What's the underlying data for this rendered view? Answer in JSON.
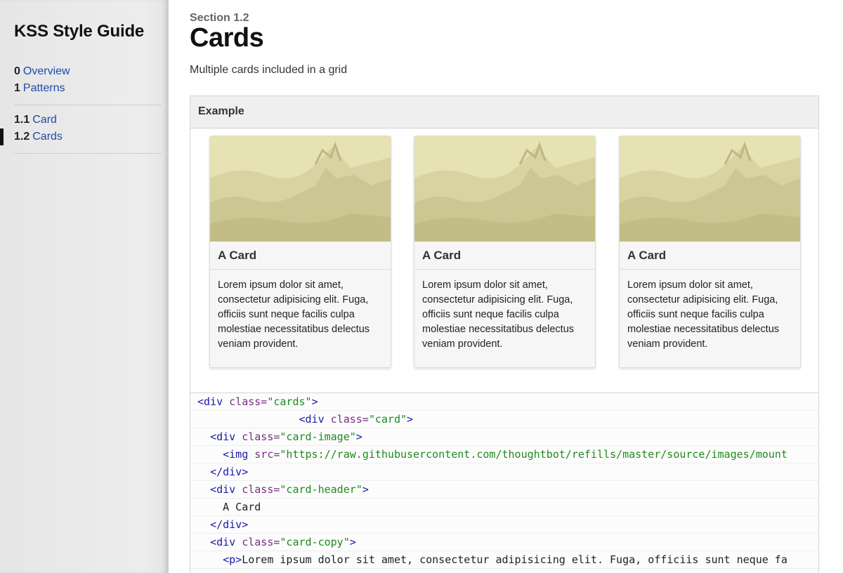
{
  "sidebar": {
    "brand": "KSS Style Guide",
    "top_items": [
      {
        "num": "0",
        "label": "Overview"
      },
      {
        "num": "1",
        "label": "Patterns"
      }
    ],
    "sub_items": [
      {
        "num": "1.1",
        "label": "Card",
        "active": false
      },
      {
        "num": "1.2",
        "label": "Cards",
        "active": true
      }
    ]
  },
  "main": {
    "section_label": "Section 1.2",
    "title": "Cards",
    "description": "Multiple cards included in a grid",
    "example_label": "Example",
    "cards": [
      {
        "header": "A Card",
        "copy": "Lorem ipsum dolor sit amet, consectetur adipisicing elit. Fuga, officiis sunt neque facilis culpa molestiae necessitatibus delectus veniam provident."
      },
      {
        "header": "A Card",
        "copy": "Lorem ipsum dolor sit amet, consectetur adipisicing elit. Fuga, officiis sunt neque facilis culpa molestiae necessitatibus delectus veniam provident."
      },
      {
        "header": "A Card",
        "copy": "Lorem ipsum dolor sit amet, consectetur adipisicing elit. Fuga, officiis sunt neque facilis culpa molestiae necessitatibus delectus veniam provident."
      }
    ],
    "code_lines": [
      {
        "indent": "",
        "parts": [
          {
            "t": "tag",
            "v": "<div "
          },
          {
            "t": "attr",
            "v": "class="
          },
          {
            "t": "str",
            "v": "\"cards\""
          },
          {
            "t": "tag",
            "v": ">"
          }
        ]
      },
      {
        "indent": "                ",
        "parts": [
          {
            "t": "tag",
            "v": "<div "
          },
          {
            "t": "attr",
            "v": "class="
          },
          {
            "t": "str",
            "v": "\"card\""
          },
          {
            "t": "tag",
            "v": ">"
          }
        ]
      },
      {
        "indent": "  ",
        "parts": [
          {
            "t": "tag",
            "v": "<div "
          },
          {
            "t": "attr",
            "v": "class="
          },
          {
            "t": "str",
            "v": "\"card-image\""
          },
          {
            "t": "tag",
            "v": ">"
          }
        ]
      },
      {
        "indent": "    ",
        "parts": [
          {
            "t": "tag",
            "v": "<img "
          },
          {
            "t": "attr",
            "v": "src="
          },
          {
            "t": "str",
            "v": "\"https://raw.githubusercontent.com/thoughtbot/refills/master/source/images/mount"
          }
        ]
      },
      {
        "indent": "  ",
        "parts": [
          {
            "t": "tag",
            "v": "</div>"
          }
        ]
      },
      {
        "indent": "  ",
        "parts": [
          {
            "t": "tag",
            "v": "<div "
          },
          {
            "t": "attr",
            "v": "class="
          },
          {
            "t": "str",
            "v": "\"card-header\""
          },
          {
            "t": "tag",
            "v": ">"
          }
        ]
      },
      {
        "indent": "    ",
        "parts": [
          {
            "t": "text",
            "v": "A Card"
          }
        ]
      },
      {
        "indent": "  ",
        "parts": [
          {
            "t": "tag",
            "v": "</div>"
          }
        ]
      },
      {
        "indent": "  ",
        "parts": [
          {
            "t": "tag",
            "v": "<div "
          },
          {
            "t": "attr",
            "v": "class="
          },
          {
            "t": "str",
            "v": "\"card-copy\""
          },
          {
            "t": "tag",
            "v": ">"
          }
        ]
      },
      {
        "indent": "    ",
        "parts": [
          {
            "t": "tag",
            "v": "<p>"
          },
          {
            "t": "text",
            "v": "Lorem ipsum dolor sit amet, consectetur adipisicing elit. Fuga, officiis sunt neque fa"
          }
        ]
      }
    ]
  },
  "colors": {
    "link": "#1f4aa8",
    "code_tag": "#1a1aa6",
    "code_attr": "#7a2b84",
    "code_string": "#1e8a1e",
    "image_tint": "#c9c48f"
  },
  "icons": [
    "mountain-landscape-image"
  ]
}
